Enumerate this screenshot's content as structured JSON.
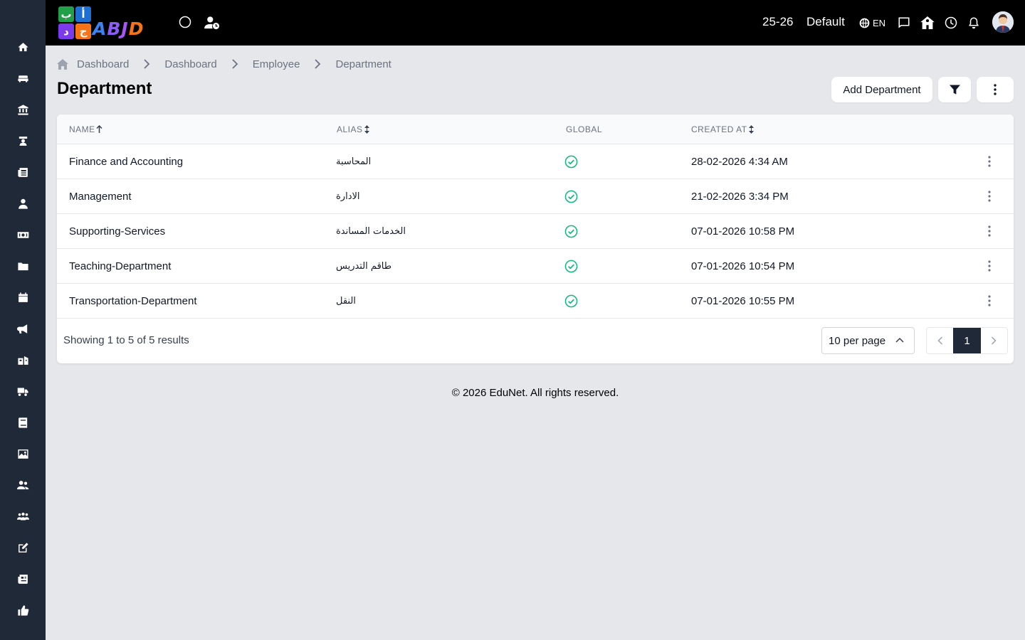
{
  "sidebar": {
    "items": [
      {
        "icon": "home-icon"
      },
      {
        "icon": "sofa-icon"
      },
      {
        "icon": "bank-icon"
      },
      {
        "icon": "teacher-icon"
      },
      {
        "icon": "newspaper-icon"
      },
      {
        "icon": "user-tie-icon"
      },
      {
        "icon": "money-icon"
      },
      {
        "icon": "folder-icon"
      },
      {
        "icon": "calendar-icon"
      },
      {
        "icon": "megaphone-icon"
      },
      {
        "icon": "school-icon"
      },
      {
        "icon": "truck-icon"
      },
      {
        "icon": "book-icon"
      },
      {
        "icon": "image-icon"
      },
      {
        "icon": "users-icon"
      },
      {
        "icon": "group-icon"
      },
      {
        "icon": "edit-icon"
      },
      {
        "icon": "news-icon"
      },
      {
        "icon": "thumbs-up-icon"
      }
    ]
  },
  "header": {
    "logo_text": "ABJD",
    "logo_tiles": [
      "ب",
      "أ",
      "د",
      "ج"
    ],
    "session": "25-26",
    "profile": "Default",
    "language": "EN"
  },
  "breadcrumb": [
    "Dashboard",
    "Dashboard",
    "Employee",
    "Department"
  ],
  "page": {
    "title": "Department",
    "add_button": "Add Department"
  },
  "table": {
    "columns": [
      "NAME",
      "ALIAS",
      "GLOBAL",
      "CREATED AT"
    ],
    "rows": [
      {
        "name": "Finance and Accounting",
        "alias": "المحاسبة",
        "global": true,
        "created_at": "28-02-2026 4:34 AM"
      },
      {
        "name": "Management",
        "alias": "الادارة",
        "global": true,
        "created_at": "21-02-2026 3:34 PM"
      },
      {
        "name": "Supporting-Services",
        "alias": "الخدمات المساندة",
        "global": true,
        "created_at": "07-01-2026 10:58 PM"
      },
      {
        "name": "Teaching-Department",
        "alias": "طاقم التدريس",
        "global": true,
        "created_at": "07-01-2026 10:54 PM"
      },
      {
        "name": "Transportation-Department",
        "alias": "النقل",
        "global": true,
        "created_at": "07-01-2026 10:55 PM"
      }
    ]
  },
  "pagination": {
    "summary": "Showing 1 to 5 of 5 results",
    "per_page": "10 per page",
    "current_page": "1"
  },
  "footer": "© 2026 EduNet. All rights reserved.",
  "colors": {
    "sidebar": "#1f2937",
    "topbar": "#000000",
    "background": "#e5e7eb",
    "check": "#10b981",
    "active_page": "#1f2937"
  }
}
